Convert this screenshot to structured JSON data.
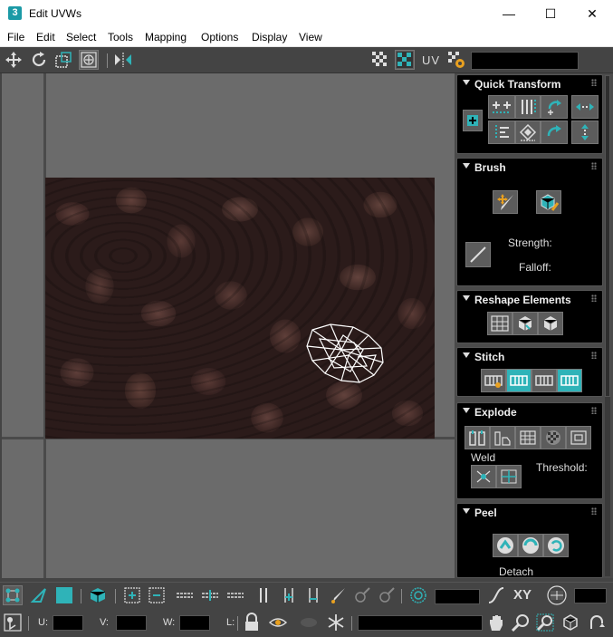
{
  "window": {
    "app_icon": "3",
    "title": "Edit UVWs",
    "minimize_glyph": "—",
    "maximize_glyph": "☐",
    "close_glyph": "✕"
  },
  "menu": {
    "items": [
      "File",
      "Edit",
      "Select",
      "Tools",
      "Mapping",
      "Options",
      "Display",
      "View"
    ]
  },
  "toolbar": {
    "uv_label": "UV",
    "icons": [
      "move-icon",
      "rotate-icon",
      "scale-icon",
      "freeform-icon",
      "mirror-icon",
      "checker-icon",
      "texture-map-icon",
      "settings-icon"
    ]
  },
  "panels": {
    "quick_transform": {
      "title": "Quick Transform"
    },
    "brush": {
      "title": "Brush",
      "strength_label": "Strength:",
      "falloff_label": "Falloff:"
    },
    "reshape_elements": {
      "title": "Reshape Elements"
    },
    "stitch": {
      "title": "Stitch"
    },
    "explode": {
      "title": "Explode",
      "weld_label": "Weld",
      "threshold_label": "Threshold:"
    },
    "peel": {
      "title": "Peel",
      "detach_label": "Detach"
    }
  },
  "bottom": {
    "xy_label": "XY",
    "u_label": "U:",
    "v_label": "V:",
    "w_label": "W:",
    "l_label": "L:"
  },
  "colors": {
    "accent": "#2fb3b8",
    "panel_bg": "#000000",
    "ui_bg": "#444444",
    "viewport_bg": "#6b6b6b"
  }
}
